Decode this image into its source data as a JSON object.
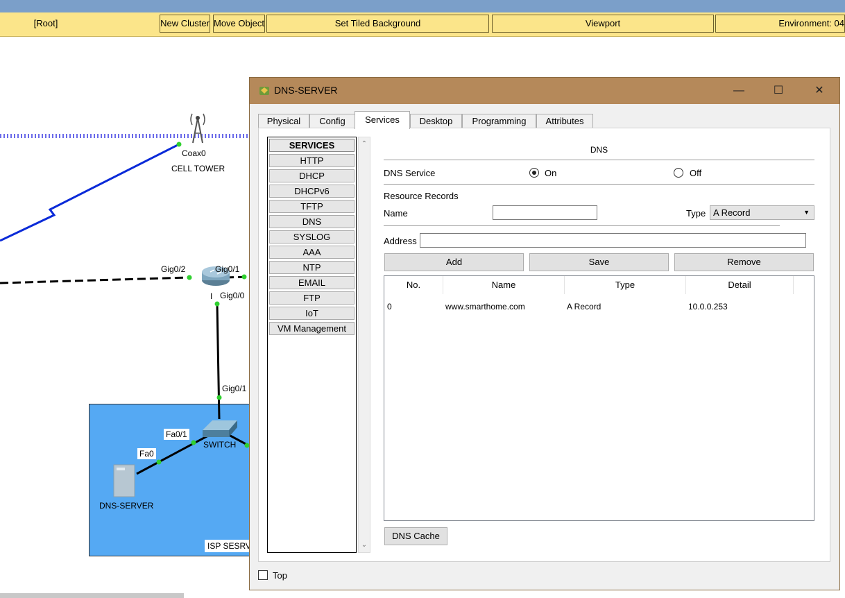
{
  "toolbar": {
    "root_label": "[Root]",
    "new_cluster": "New Cluster",
    "move_object": "Move Object",
    "set_tiled_background": "Set Tiled Background",
    "viewport": "Viewport",
    "environment": "Environment: 04"
  },
  "topology": {
    "coax_label": "Coax0",
    "cell_tower": "CELL TOWER",
    "gig0_2": "Gig0/2",
    "gig0_1_router": "Gig0/1",
    "gig0_0": "Gig0/0",
    "router_prefix": "I",
    "gig0_1_switch": "Gig0/1",
    "fa0_1": "Fa0/1",
    "fa0": "Fa0",
    "switch_label": "SWITCH",
    "server_label": "DNS-SERVER",
    "isp_label": "ISP SESRV"
  },
  "dialog": {
    "title": "DNS-SERVER",
    "tabs": [
      {
        "label": "Physical"
      },
      {
        "label": "Config"
      },
      {
        "label": "Services",
        "active": true
      },
      {
        "label": "Desktop"
      },
      {
        "label": "Programming"
      },
      {
        "label": "Attributes"
      }
    ],
    "services_header": "SERVICES",
    "services": [
      "HTTP",
      "DHCP",
      "DHCPv6",
      "TFTP",
      "DNS",
      "SYSLOG",
      "AAA",
      "NTP",
      "EMAIL",
      "FTP",
      "IoT",
      "VM Management"
    ],
    "dns": {
      "section_title": "DNS",
      "service_label": "DNS Service",
      "on_label": "On",
      "off_label": "Off",
      "service_on": true,
      "resource_records": "Resource Records",
      "name_label": "Name",
      "name_value": "",
      "type_label": "Type",
      "type_value": "A Record",
      "address_label": "Address",
      "address_value": "",
      "add": "Add",
      "save": "Save",
      "remove": "Remove",
      "columns": [
        "No.",
        "Name",
        "Type",
        "Detail"
      ],
      "records": [
        {
          "no": "0",
          "name": "www.smarthome.com",
          "type": "A Record",
          "detail": "10.0.0.253"
        }
      ],
      "cache_button": "DNS Cache"
    },
    "top_label": "Top"
  },
  "colors": {
    "toolbar": "#fbe58a",
    "titlebar": "#b5895a",
    "isp_zone": "#55a9f3",
    "link_blue": "#0a2ad8"
  }
}
